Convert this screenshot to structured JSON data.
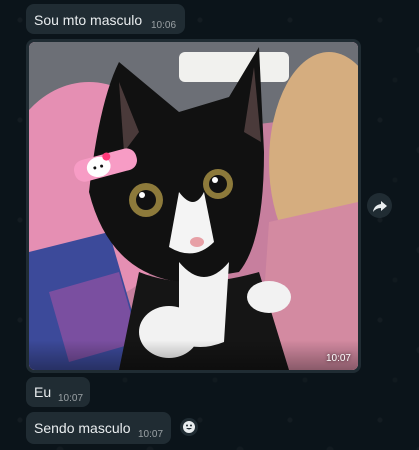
{
  "messages": [
    {
      "text": "Sou mto masculo",
      "time": "10:06"
    },
    {
      "type": "image",
      "image_alt": "black and white kitten with pink hair clip",
      "time": "10:07"
    },
    {
      "text": "Eu",
      "time": "10:07"
    },
    {
      "text": "Sendo masculo",
      "time": "10:07"
    }
  ],
  "icons": {
    "forward": "forward-arrow-icon",
    "reaction": "smiley-icon"
  },
  "colors": {
    "chat_background": "#0b141a",
    "bubble_incoming": "#202c33",
    "text_primary": "#e9edef"
  }
}
